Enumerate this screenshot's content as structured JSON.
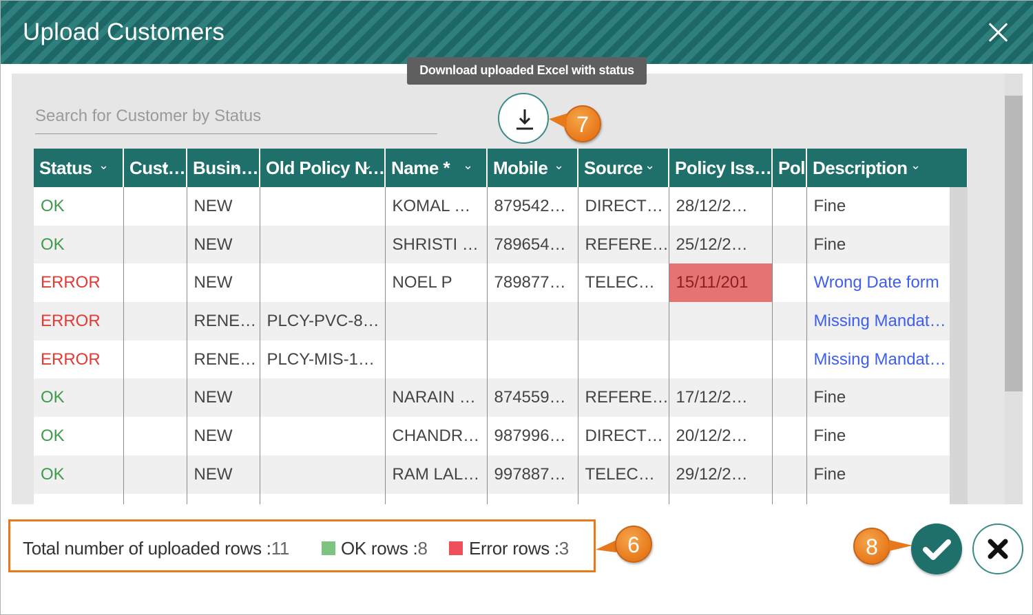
{
  "dialog": {
    "title": "Upload Customers"
  },
  "search": {
    "placeholder": "Search for Customer by Status"
  },
  "tooltip": {
    "text": "Download uploaded Excel with status"
  },
  "table": {
    "columns": [
      "Status",
      "Cust…",
      "Busin…",
      "Old Policy N…",
      "Name *",
      "Mobile",
      "Source",
      "Policy Iss…",
      "Pol",
      "Description"
    ],
    "rows": [
      [
        "OK",
        "",
        "NEW",
        "",
        "KOMAL …",
        "879542…",
        "DIRECT…",
        "28/12/2…",
        "",
        "Fine"
      ],
      [
        "OK",
        "",
        "NEW",
        "",
        "SHRISTI …",
        "789654…",
        "REFERE…",
        "25/12/2…",
        "",
        "Fine"
      ],
      [
        "ERROR",
        "",
        "NEW",
        "",
        "NOEL P",
        "789877…",
        "TELEC…",
        "15/11/201",
        "",
        "Wrong Date form"
      ],
      [
        "ERROR",
        "",
        "RENE…",
        "PLCY-PVC-8…",
        "",
        "",
        "",
        "",
        "",
        "Missing Mandat…"
      ],
      [
        "ERROR",
        "",
        "RENE…",
        "PLCY-MIS-1…",
        "",
        "",
        "",
        "",
        "",
        "Missing Mandat…"
      ],
      [
        "OK",
        "",
        "NEW",
        "",
        "NARAIN …",
        "874559…",
        "REFERE…",
        "17/12/2…",
        "",
        "Fine"
      ],
      [
        "OK",
        "",
        "NEW",
        "",
        "CHANDR…",
        "987996…",
        "DIRECT…",
        "20/12/2…",
        "",
        "Fine"
      ],
      [
        "OK",
        "",
        "NEW",
        "",
        "RAM LAL…",
        "997887…",
        "TELEC…",
        "29/12/2…",
        "",
        "Fine"
      ]
    ]
  },
  "summary": {
    "total_label": "Total number of uploaded rows :",
    "total_value": "11",
    "ok_label": "OK rows :",
    "ok_value": "8",
    "error_label": "Error rows :",
    "error_value": "3"
  },
  "callouts": {
    "six": "6",
    "seven": "7",
    "eight": "8"
  },
  "colors": {
    "header": "#1f6f6b",
    "ok": "#3e9a4a",
    "error": "#e53935",
    "ok_swatch": "#7cc47f",
    "error_swatch": "#ef4f5b",
    "callout": "#e8791b"
  },
  "icons": {
    "close": "close-icon",
    "download": "download-icon",
    "confirm": "check-icon",
    "cancel": "cancel-x-icon"
  }
}
